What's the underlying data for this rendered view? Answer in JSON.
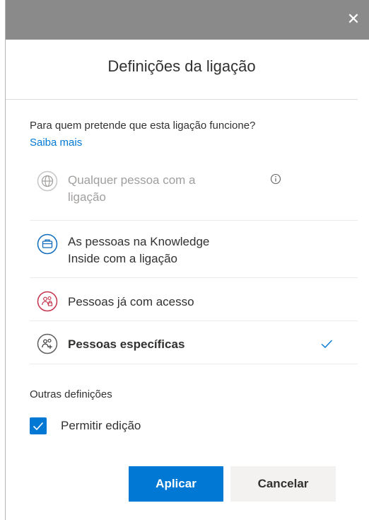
{
  "dialog": {
    "title": "Definições da ligação",
    "close_glyph": "✕"
  },
  "audience": {
    "question": "Para quem pretende que esta ligação funcione?",
    "learn_more": "Saiba mais",
    "options": [
      {
        "line1": "Qualquer pessoa com a",
        "line2": "ligação",
        "icon": "globe-icon",
        "disabled": true,
        "has_info": true
      },
      {
        "line1": "As pessoas na Knowledge",
        "line2": "Inside com a ligação",
        "icon": "organization-icon",
        "disabled": false
      },
      {
        "line1": "Pessoas já com acesso",
        "icon": "people-lock-icon",
        "disabled": false
      },
      {
        "line1": "Pessoas específicas",
        "icon": "people-add-icon",
        "disabled": false,
        "selected": true
      }
    ]
  },
  "other_settings": {
    "heading": "Outras definições",
    "allow_edit_label": "Permitir edição",
    "allow_edit_checked": true
  },
  "actions": {
    "apply_label": "Aplicar",
    "cancel_label": "Cancelar"
  },
  "colors": {
    "accent": "#0078d4",
    "titlebar": "#8a8a8a",
    "org_icon": "#0f6cbd",
    "access_icon": "#c4314b"
  }
}
